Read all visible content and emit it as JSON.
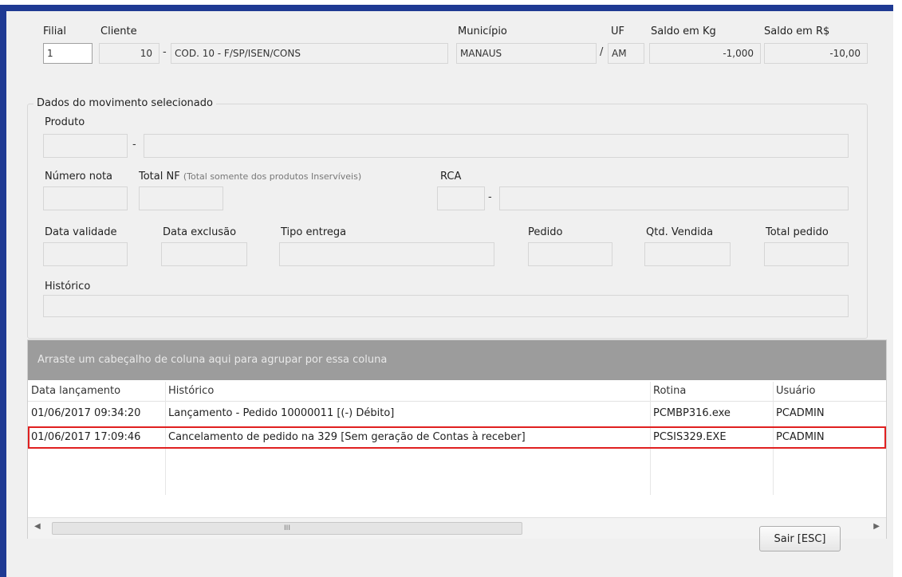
{
  "header": {
    "filial": {
      "label": "Filial",
      "value": "1"
    },
    "cliente": {
      "label": "Cliente",
      "code": "10",
      "name": "COD. 10 - F/SP/ISEN/CONS"
    },
    "municipio": {
      "label": "Município",
      "value": "MANAUS"
    },
    "uf": {
      "label": "UF",
      "value": "AM"
    },
    "saldo_kg": {
      "label": "Saldo em Kg",
      "value": "-1,000"
    },
    "saldo_rs": {
      "label": "Saldo em R$",
      "value": "-10,00"
    }
  },
  "details": {
    "title": "Dados do movimento selecionado",
    "produto_label": "Produto",
    "numero_nota_label": "Número nota",
    "total_nf_label": "Total NF",
    "total_nf_hint": "(Total somente dos produtos Inservíveis)",
    "rca_label": "RCA",
    "data_validade_label": "Data validade",
    "data_exclusao_label": "Data exclusão",
    "tipo_entrega_label": "Tipo entrega",
    "pedido_label": "Pedido",
    "qtd_vendida_label": "Qtd. Vendida",
    "total_pedido_label": "Total pedido",
    "historico_label": "Histórico"
  },
  "grid": {
    "group_hint": "Arraste um cabeçalho de coluna aqui para agrupar por essa coluna",
    "columns": [
      "Data lançamento",
      "Histórico",
      "Rotina",
      "Usuário"
    ],
    "rows": [
      [
        "01/06/2017 09:34:20",
        "Lançamento - Pedido 10000011 [(-) Débito]",
        "PCMBP316.exe",
        "PCADMIN"
      ],
      [
        "01/06/2017 17:09:46",
        "Cancelamento de pedido na 329 [Sem geração de Contas à receber]",
        "PCSIS329.EXE",
        "PCADMIN"
      ]
    ],
    "highlight_row": 1,
    "scroll_thumb_grip": "III"
  },
  "footer": {
    "exit_button": "Sair [ESC]"
  },
  "colors": {
    "frame": "#1f3a93",
    "highlight": "#e02020",
    "group_panel": "#9c9c9c"
  }
}
